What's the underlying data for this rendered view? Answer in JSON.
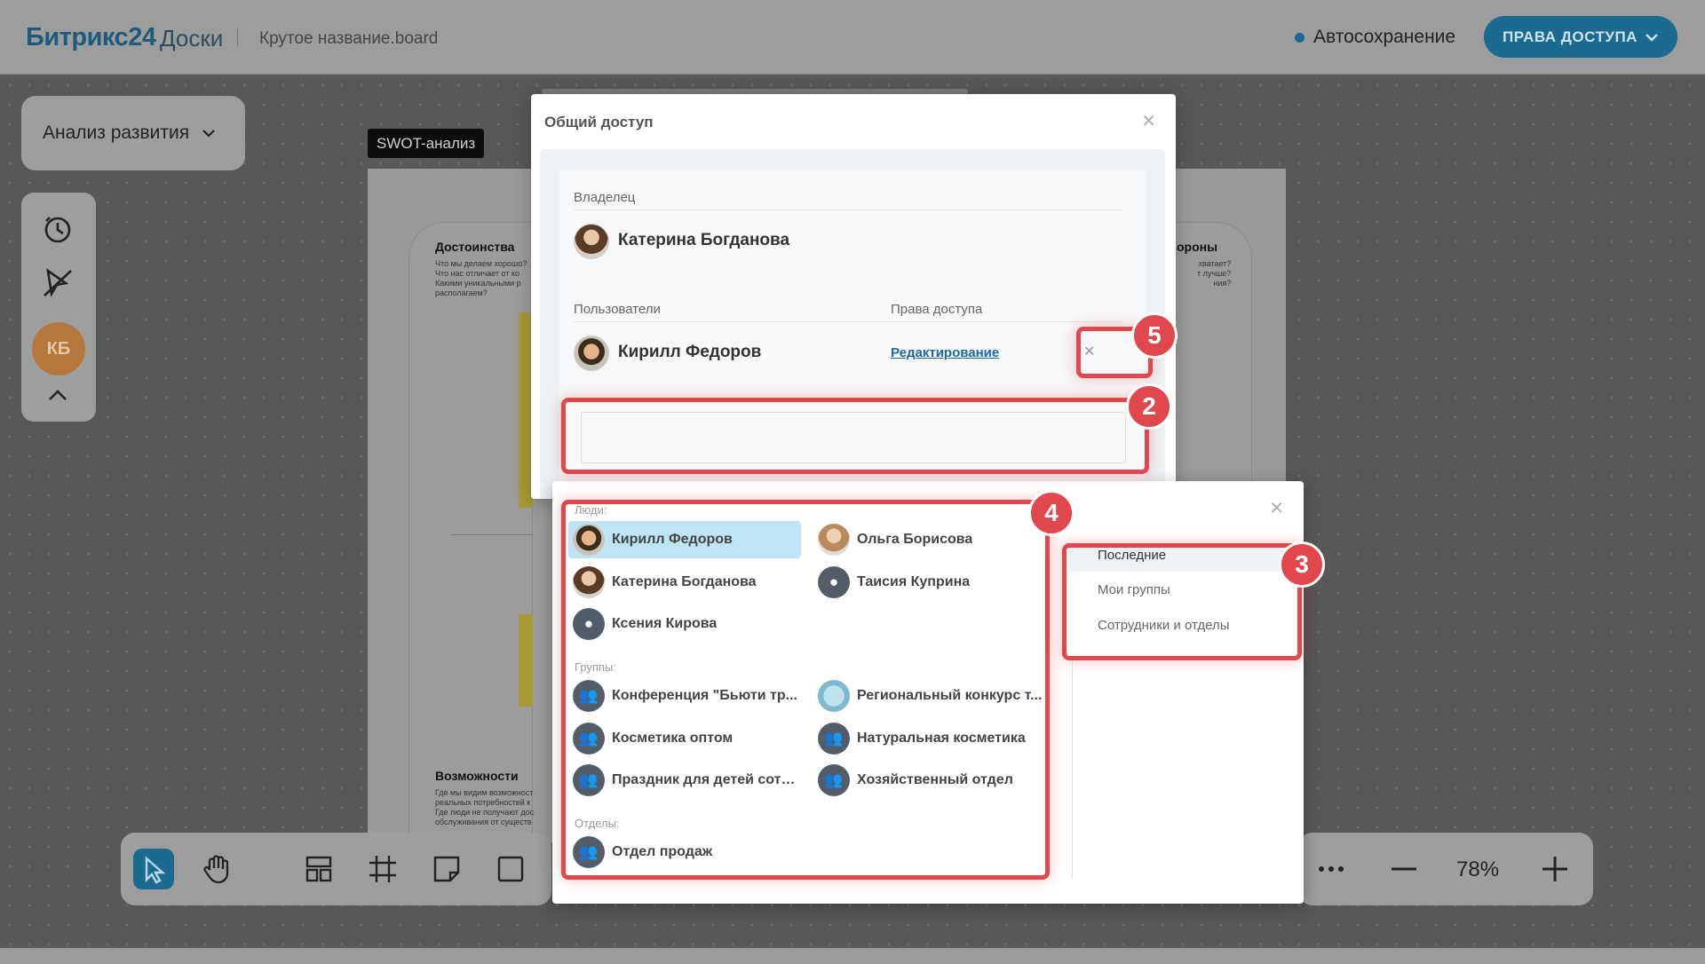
{
  "header": {
    "logo_main": "Битрикс",
    "logo_num": "24",
    "logo_sub": "Доски",
    "board_name": "Крутое название.board",
    "autosave": "Автосохранение",
    "access_button": "ПРАВА ДОСТУПА"
  },
  "canvas": {
    "selector_label": "Анализ развития",
    "swot_tag": "SWOT-анализ",
    "user_initials": "КБ",
    "zoom": "78%",
    "cards": {
      "strengths_title": "Достоинства",
      "strengths_text": [
        "Что мы делаем хорошо?",
        "Что нас отличает от ко",
        "Какими уникальными р",
        "располагаем?"
      ],
      "weak_title": "ороны",
      "weak_text": [
        "хватает?",
        "т лучше?",
        "ния?"
      ],
      "opportunities_title": "Возможности",
      "opportunities_text": [
        "Где мы видим возможност",
        "реальных потребностей к",
        "Где люди не получают дос",
        "обслуживания от существ"
      ]
    },
    "colors": {
      "accent": "#1b6a8f",
      "highlight": "#e0484e"
    }
  },
  "modal": {
    "title": "Общий доступ",
    "owner_label": "Владелец",
    "owner_name": "Катерина Богданова",
    "users_label": "Пользователи",
    "rights_label": "Права доступа",
    "user_name": "Кирилл Федоров",
    "user_right": "Редактирование",
    "search_placeholder": ""
  },
  "dropdown": {
    "people_label": "Люди:",
    "groups_label": "Группы:",
    "departments_label": "Отделы:",
    "people": [
      {
        "name": "Кирилл Федоров",
        "avatar": "photo-m",
        "selected": true
      },
      {
        "name": "Ольга Борисова",
        "avatar": "photo-f2"
      },
      {
        "name": "Катерина Богданова",
        "avatar": "photo-f"
      },
      {
        "name": "Таисия Куприна",
        "avatar": "user-icon"
      },
      {
        "name": "Ксения Кирова",
        "avatar": "user-icon"
      }
    ],
    "groups": [
      {
        "name": "Конференция \"Бьюти тр...",
        "avatar": "group-icon"
      },
      {
        "name": "Региональный конкурс т...",
        "avatar": "photo-g"
      },
      {
        "name": "Косметика оптом",
        "avatar": "group-icon"
      },
      {
        "name": "Натуральная косметика",
        "avatar": "group-icon"
      },
      {
        "name": "Праздник для детей сотр...",
        "avatar": "group-icon"
      },
      {
        "name": "Хозяйственный отдел",
        "avatar": "group-icon"
      }
    ],
    "departments": [
      {
        "name": "Отдел продаж",
        "avatar": "group-icon"
      }
    ],
    "tabs": [
      "Последние",
      "Мои группы",
      "Сотрудники и отделы"
    ]
  },
  "badges": [
    "5",
    "2",
    "4",
    "3"
  ]
}
